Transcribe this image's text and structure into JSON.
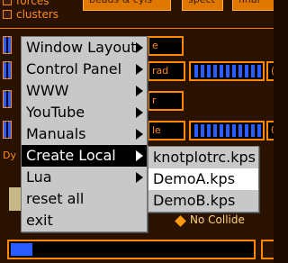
{
  "background": {
    "checkbox_labels": {
      "forces": "forces",
      "clusters": "clusters"
    },
    "top_buttons": {
      "beads": "beads & cyls",
      "spect": "spect",
      "final": "final"
    },
    "fields": {
      "field1": "e",
      "field2": "rad",
      "field3": "r",
      "field4": "le"
    },
    "right_numbers": {
      "r1": "(",
      "r3": "0"
    },
    "side_label": "Dy",
    "no_collide": "No Collide"
  },
  "main_menu": {
    "items": [
      {
        "label": "Window Layout",
        "has_submenu": true
      },
      {
        "label": "Control Panel",
        "has_submenu": true
      },
      {
        "label": "WWW",
        "has_submenu": true
      },
      {
        "label": "YouTube",
        "has_submenu": true
      },
      {
        "label": "Manuals",
        "has_submenu": true
      },
      {
        "label": "Create Local",
        "has_submenu": true,
        "active": true
      },
      {
        "label": "Lua",
        "has_submenu": true
      },
      {
        "label": "reset all",
        "has_submenu": false
      },
      {
        "label": "exit",
        "has_submenu": false
      }
    ]
  },
  "create_local_submenu": {
    "items": [
      {
        "label": "knotplotrc.kps"
      },
      {
        "label": "DemoA.kps",
        "selected": true
      },
      {
        "label": "DemoB.kps"
      }
    ]
  },
  "colors": {
    "accent_orange": "#ff8800",
    "slider_blue": "#2a5cff",
    "menu_bg": "#c8c8c8",
    "highlight": "#000000"
  }
}
